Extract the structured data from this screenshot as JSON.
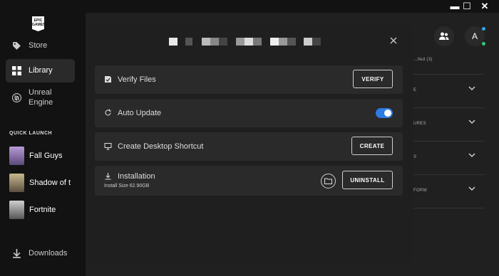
{
  "window": {
    "minimize": "▬",
    "maximize": "☐",
    "close": "✕"
  },
  "sidebar": {
    "logo_text": "EPIC GAMES",
    "items": [
      {
        "label": "Store",
        "icon": "tag-icon",
        "active": false
      },
      {
        "label": "Library",
        "icon": "grid-icon",
        "active": true
      },
      {
        "label": "Unreal Engine",
        "icon": "unreal-icon",
        "active": false
      }
    ],
    "quick_launch_title": "QUICK LAUNCH",
    "quick_launch": [
      {
        "label": "Fall Guys",
        "thumb": "#6a5a8a"
      },
      {
        "label": "Shadow of t",
        "thumb": "#7a6a4a"
      },
      {
        "label": "Fortnite",
        "thumb": "#8a8a8a"
      }
    ],
    "downloads": "Downloads"
  },
  "topbar": {
    "avatar_letter": "A",
    "friends_icon": "friends-icon",
    "online_dot": "#2fa9e8",
    "status_dot": "#2ecc71"
  },
  "background": {
    "rows": [
      "...lled (3)",
      "E",
      "URES",
      "S",
      "FORM"
    ]
  },
  "modal": {
    "close_icon": "close-icon",
    "options": {
      "verify": {
        "label": "Verify Files",
        "button": "VERIFY"
      },
      "auto_update": {
        "label": "Auto Update",
        "enabled": true
      },
      "shortcut": {
        "label": "Create Desktop Shortcut",
        "button": "CREATE"
      },
      "installation": {
        "label": "Installation",
        "size": "Install Size 62.90GB",
        "button": "UNINSTALL"
      }
    }
  },
  "colors": {
    "accent": "#2c7be5",
    "sidebar_active": "#2a2a2a",
    "card": "#2a2a2a",
    "modal": "#1f1f1f"
  }
}
